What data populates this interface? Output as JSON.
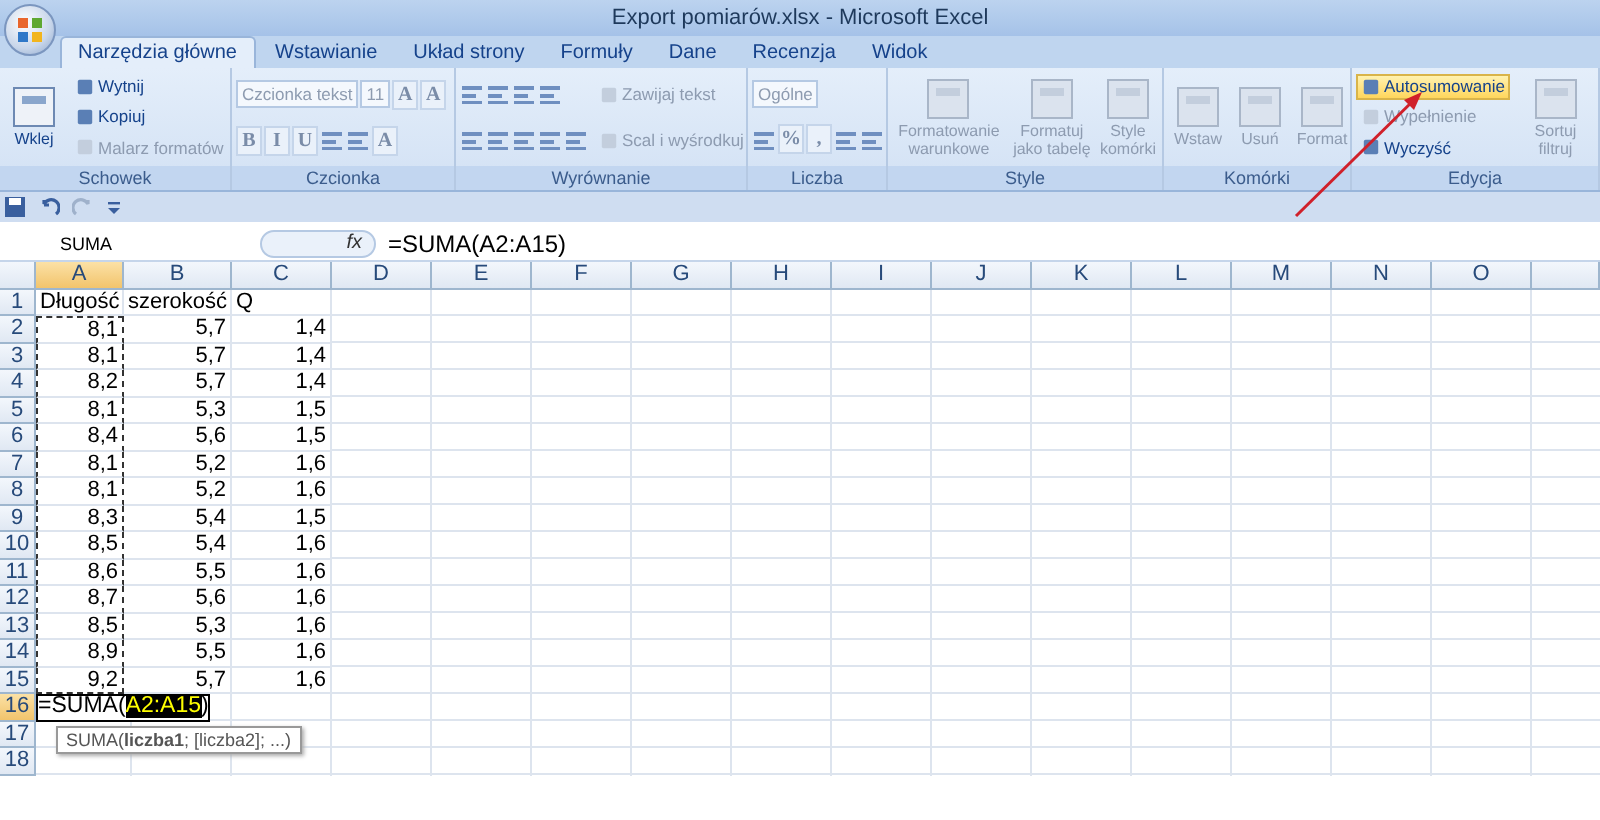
{
  "window": {
    "title": "Export pomiarów.xlsx - Microsoft Excel"
  },
  "tabs": [
    {
      "label": "Narzędzia główne",
      "selected": true
    },
    {
      "label": "Wstawianie",
      "selected": false
    },
    {
      "label": "Układ strony",
      "selected": false
    },
    {
      "label": "Formuły",
      "selected": false
    },
    {
      "label": "Dane",
      "selected": false
    },
    {
      "label": "Recenzja",
      "selected": false
    },
    {
      "label": "Widok",
      "selected": false
    }
  ],
  "ribbon": [
    {
      "name": "Schowek",
      "columns": [
        [
          [
            {
              "kind": "large",
              "label": "Wklej",
              "disabled": false
            }
          ]
        ],
        [
          [
            {
              "kind": "small",
              "label": "Wytnij",
              "disabled": false
            }
          ],
          [
            {
              "kind": "small",
              "label": "Kopiuj",
              "disabled": false
            }
          ],
          [
            {
              "kind": "small",
              "label": "Malarz formatów",
              "disabled": true
            }
          ]
        ]
      ]
    },
    {
      "name": "Czcionka",
      "columns": [
        [
          [
            {
              "kind": "field",
              "label": "Czcionka tekst"
            },
            {
              "kind": "field",
              "label": "11"
            },
            {
              "kind": "key",
              "label": "A"
            },
            {
              "kind": "key",
              "label": "A"
            }
          ],
          [
            {
              "kind": "key",
              "label": "B"
            },
            {
              "kind": "key",
              "label": "I"
            },
            {
              "kind": "key",
              "label": "U"
            },
            {
              "kind": "icon"
            },
            {
              "kind": "icon"
            },
            {
              "kind": "key",
              "label": "A"
            }
          ]
        ]
      ]
    },
    {
      "name": "Wyrównanie",
      "columns": [
        [
          [
            {
              "kind": "icon"
            },
            {
              "kind": "icon"
            },
            {
              "kind": "icon"
            },
            {
              "kind": "icon"
            }
          ],
          [
            {
              "kind": "icon"
            },
            {
              "kind": "icon"
            },
            {
              "kind": "icon"
            },
            {
              "kind": "icon"
            },
            {
              "kind": "icon"
            }
          ]
        ],
        [
          [
            {
              "kind": "small",
              "label": "Zawijaj tekst",
              "disabled": true
            }
          ],
          [
            {
              "kind": "small",
              "label": "Scal i wyśrodkuj",
              "disabled": true
            }
          ]
        ]
      ]
    },
    {
      "name": "Liczba",
      "columns": [
        [
          [
            {
              "kind": "field",
              "label": "Ogólne"
            }
          ],
          [
            {
              "kind": "icon"
            },
            {
              "kind": "key",
              "label": "%"
            },
            {
              "kind": "key",
              "label": ","
            },
            {
              "kind": "icon"
            },
            {
              "kind": "icon"
            }
          ]
        ]
      ]
    },
    {
      "name": "Style",
      "columns": [
        [
          [
            {
              "kind": "large",
              "label": "Formatowanie warunkowe",
              "disabled": true
            },
            {
              "kind": "large",
              "label": "Formatuj jako tabelę",
              "disabled": true
            },
            {
              "kind": "large",
              "label": "Style komórki",
              "disabled": true
            }
          ]
        ]
      ]
    },
    {
      "name": "Komórki",
      "columns": [
        [
          [
            {
              "kind": "large",
              "label": "Wstaw",
              "disabled": true
            },
            {
              "kind": "large",
              "label": "Usuń",
              "disabled": true
            },
            {
              "kind": "large",
              "label": "Format",
              "disabled": true
            }
          ]
        ]
      ]
    },
    {
      "name": "Edycja",
      "columns": [
        [
          [
            {
              "kind": "small",
              "label": "Autosumowanie",
              "disabled": false,
              "selected": true
            }
          ],
          [
            {
              "kind": "small",
              "label": "Wypełnienie",
              "disabled": true,
              "selected": false
            }
          ],
          [
            {
              "kind": "small",
              "label": "Wyczyść",
              "disabled": false,
              "selected": false
            }
          ]
        ],
        [
          [
            {
              "kind": "large",
              "label": "Sortuj filtruj",
              "disabled": true
            }
          ]
        ]
      ]
    }
  ],
  "formula_bar": {
    "name_box": "SUMA",
    "fx": "fx",
    "formula": "=SUMA(A2:A15)"
  },
  "grid": {
    "columns": [
      {
        "label": "A",
        "selected": true
      },
      {
        "label": "B",
        "selected": false
      },
      {
        "label": "C",
        "selected": false
      },
      {
        "label": "D",
        "selected": false
      },
      {
        "label": "E",
        "selected": false
      },
      {
        "label": "F",
        "selected": false
      },
      {
        "label": "G",
        "selected": false
      },
      {
        "label": "H",
        "selected": false
      },
      {
        "label": "I",
        "selected": false
      },
      {
        "label": "J",
        "selected": false
      },
      {
        "label": "K",
        "selected": false
      },
      {
        "label": "L",
        "selected": false
      },
      {
        "label": "M",
        "selected": false
      },
      {
        "label": "N",
        "selected": false
      },
      {
        "label": "O",
        "selected": false
      }
    ],
    "rows": [
      {
        "label": "1",
        "selected": false,
        "copied": false,
        "cells": [
          "Długość",
          "szerokość",
          "Q"
        ]
      },
      {
        "label": "2",
        "selected": false,
        "copied": true,
        "cells": [
          "8,1",
          "5,7",
          "1,4"
        ]
      },
      {
        "label": "3",
        "selected": false,
        "copied": true,
        "cells": [
          "8,1",
          "5,7",
          "1,4"
        ]
      },
      {
        "label": "4",
        "selected": false,
        "copied": true,
        "cells": [
          "8,2",
          "5,7",
          "1,4"
        ]
      },
      {
        "label": "5",
        "selected": false,
        "copied": true,
        "cells": [
          "8,1",
          "5,3",
          "1,5"
        ]
      },
      {
        "label": "6",
        "selected": false,
        "copied": true,
        "cells": [
          "8,4",
          "5,6",
          "1,5"
        ]
      },
      {
        "label": "7",
        "selected": false,
        "copied": true,
        "cells": [
          "8,1",
          "5,2",
          "1,6"
        ]
      },
      {
        "label": "8",
        "selected": false,
        "copied": true,
        "cells": [
          "8,1",
          "5,2",
          "1,6"
        ]
      },
      {
        "label": "9",
        "selected": false,
        "copied": true,
        "cells": [
          "8,3",
          "5,4",
          "1,5"
        ]
      },
      {
        "label": "10",
        "selected": false,
        "copied": true,
        "cells": [
          "8,5",
          "5,4",
          "1,6"
        ]
      },
      {
        "label": "11",
        "selected": false,
        "copied": true,
        "cells": [
          "8,6",
          "5,5",
          "1,6"
        ]
      },
      {
        "label": "12",
        "selected": false,
        "copied": true,
        "cells": [
          "8,7",
          "5,6",
          "1,6"
        ]
      },
      {
        "label": "13",
        "selected": false,
        "copied": true,
        "cells": [
          "8,5",
          "5,3",
          "1,6"
        ]
      },
      {
        "label": "14",
        "selected": false,
        "copied": true,
        "cells": [
          "8,9",
          "5,5",
          "1,6"
        ]
      },
      {
        "label": "15",
        "selected": false,
        "copied": true,
        "cells": [
          "9,2",
          "5,7",
          "1,6"
        ]
      },
      {
        "label": "16",
        "selected": true,
        "copied": false,
        "cells": [],
        "editor": {
          "prefix": "=SUMA(",
          "reference": "A2:A15",
          "suffix": ")",
          "tooltip": "SUMA(**liczba1**; [liczba2]; ...)"
        }
      },
      {
        "label": "17",
        "selected": false,
        "copied": false,
        "cells": []
      },
      {
        "label": "18",
        "selected": false,
        "copied": false,
        "cells": []
      }
    ]
  }
}
